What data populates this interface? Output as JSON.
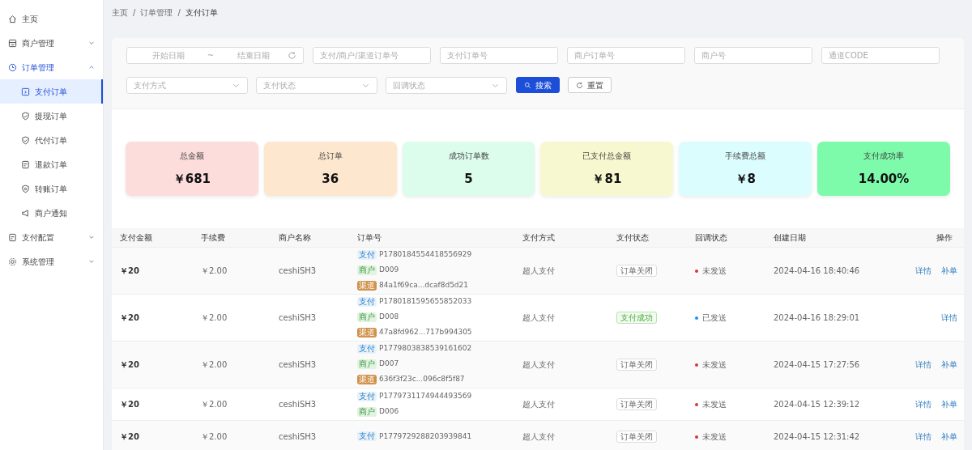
{
  "sidebar": {
    "items": [
      {
        "label": "主页"
      },
      {
        "label": "商户管理",
        "expanded": false
      },
      {
        "label": "订单管理",
        "expanded": true,
        "children": [
          {
            "label": "支付订单",
            "selected": true
          },
          {
            "label": "提现订单",
            "selected": false
          },
          {
            "label": "代付订单",
            "selected": false
          },
          {
            "label": "退款订单",
            "selected": false
          },
          {
            "label": "转账订单",
            "selected": false
          },
          {
            "label": "商户通知",
            "selected": false
          }
        ]
      },
      {
        "label": "支付配置",
        "expanded": false
      },
      {
        "label": "系统管理",
        "expanded": false
      }
    ]
  },
  "breadcrumb": {
    "separator": "/",
    "items": [
      "主页",
      "订单管理",
      "支付订单"
    ]
  },
  "filters": {
    "date_range": {
      "start_placeholder": "开始日期",
      "separator": "~",
      "end_placeholder": "结束日期"
    },
    "text_fields": [
      {
        "placeholder": "支付/商户/渠道订单号"
      },
      {
        "placeholder": "支付订单号"
      },
      {
        "placeholder": "商户订单号"
      },
      {
        "placeholder": "商户号"
      },
      {
        "placeholder": "通道CODE"
      }
    ],
    "selects": [
      {
        "placeholder": "支付方式"
      },
      {
        "placeholder": "支付状态"
      },
      {
        "placeholder": "回调状态"
      }
    ],
    "buttons": [
      {
        "kind": "search",
        "label": "搜索"
      },
      {
        "kind": "reset",
        "label": "重置"
      }
    ]
  },
  "stats": [
    {
      "label": "总金额",
      "value": "￥681",
      "color": "#fddcdc"
    },
    {
      "label": "总订单",
      "value": "36",
      "color": "#fde7cf"
    },
    {
      "label": "成功订单数",
      "value": "5",
      "color": "#dcfcec"
    },
    {
      "label": "已支付总金额",
      "value": "￥81",
      "color": "#f8f8d0"
    },
    {
      "label": "手续费总额",
      "value": "￥8",
      "color": "#dcfdfd"
    },
    {
      "label": "支付成功率",
      "value": "14.00%",
      "color": "#7dfbab"
    }
  ],
  "table": {
    "columns": [
      "支付金额",
      "手续费",
      "商户名称",
      "订单号",
      "支付方式",
      "支付状态",
      "回调状态",
      "创建日期",
      "操作"
    ],
    "rows": [
      {
        "amount": "￥20",
        "fee": "￥2.00",
        "merchant": "ceshiSH3",
        "order_ids": [
          {
            "tag": "支付",
            "kind": "pay",
            "value": "P1780184554418556929"
          },
          {
            "tag": "商户",
            "kind": "merchant",
            "value": "D009"
          },
          {
            "tag": "渠道",
            "kind": "channel",
            "value": "84a1f69ca...dcaf8d5d21"
          }
        ],
        "method": "超人支付",
        "pay_status": {
          "text": "订单关闭",
          "kind": "closed"
        },
        "callback": {
          "text": "未发送",
          "color": "#d9363e"
        },
        "created": "2024-04-16 18:40:46",
        "actions": [
          "详情",
          "补单"
        ]
      },
      {
        "amount": "￥20",
        "fee": "￥2.00",
        "merchant": "ceshiSH3",
        "order_ids": [
          {
            "tag": "支付",
            "kind": "pay",
            "value": "P1780181595655852033"
          },
          {
            "tag": "商户",
            "kind": "merchant",
            "value": "D008"
          },
          {
            "tag": "渠道",
            "kind": "channel",
            "value": "47a8fd962...717b994305"
          }
        ],
        "method": "超人支付",
        "pay_status": {
          "text": "支付成功",
          "kind": "success"
        },
        "callback": {
          "text": "已发送",
          "color": "#1890ff"
        },
        "created": "2024-04-16 18:29:01",
        "actions": [
          "详情"
        ]
      },
      {
        "amount": "￥20",
        "fee": "￥2.00",
        "merchant": "ceshiSH3",
        "order_ids": [
          {
            "tag": "支付",
            "kind": "pay",
            "value": "P1779803838539161602"
          },
          {
            "tag": "商户",
            "kind": "merchant",
            "value": "D007"
          },
          {
            "tag": "渠道",
            "kind": "channel",
            "value": "636f3f23c...096c8f5f87"
          }
        ],
        "method": "超人支付",
        "pay_status": {
          "text": "订单关闭",
          "kind": "closed"
        },
        "callback": {
          "text": "未发送",
          "color": "#d9363e"
        },
        "created": "2024-04-15 17:27:56",
        "actions": [
          "详情",
          "补单"
        ]
      },
      {
        "amount": "￥20",
        "fee": "￥2.00",
        "merchant": "ceshiSH3",
        "order_ids": [
          {
            "tag": "支付",
            "kind": "pay",
            "value": "P1779731174944493569"
          },
          {
            "tag": "商户",
            "kind": "merchant",
            "value": "D006"
          }
        ],
        "method": "超人支付",
        "pay_status": {
          "text": "订单关闭",
          "kind": "closed"
        },
        "callback": {
          "text": "未发送",
          "color": "#d9363e"
        },
        "created": "2024-04-15 12:39:12",
        "actions": [
          "详情",
          "补单"
        ]
      },
      {
        "amount": "￥20",
        "fee": "￥2.00",
        "merchant": "ceshiSH3",
        "order_ids": [
          {
            "tag": "支付",
            "kind": "pay",
            "value": "P1779729288203939841"
          }
        ],
        "method": "超人支付",
        "pay_status": {
          "text": "订单关闭",
          "kind": "closed"
        },
        "callback": {
          "text": "未发送",
          "color": "#d9363e"
        },
        "created": "2024-04-15 12:31:42",
        "actions": [
          "详情",
          "补单"
        ]
      }
    ]
  }
}
